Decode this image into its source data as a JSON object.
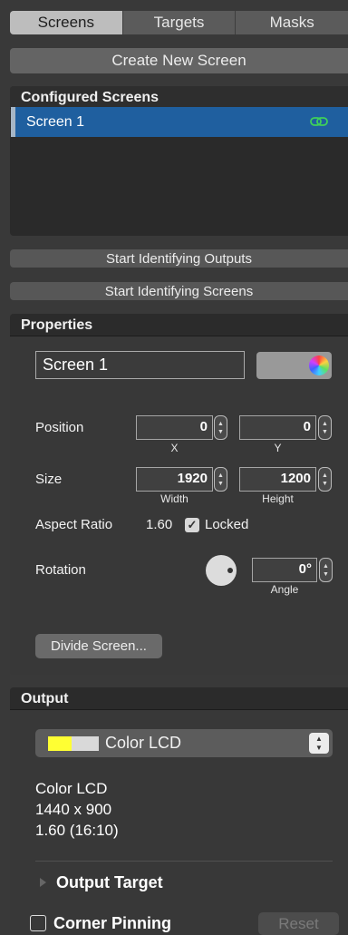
{
  "tabs": [
    {
      "label": "Screens",
      "active": true
    },
    {
      "label": "Targets",
      "active": false
    },
    {
      "label": "Masks",
      "active": false
    }
  ],
  "create_button": "Create New Screen",
  "configured": {
    "title": "Configured Screens",
    "items": [
      {
        "label": "Screen 1",
        "selected": true,
        "icon": "link-icon"
      }
    ]
  },
  "identify_outputs": "Start Identifying Outputs",
  "identify_screens": "Start Identifying Screens",
  "properties": {
    "title": "Properties",
    "name": "Screen 1",
    "position_label": "Position",
    "x_value": "0",
    "x_label": "X",
    "y_value": "0",
    "y_label": "Y",
    "size_label": "Size",
    "width_value": "1920",
    "width_label": "Width",
    "height_value": "1200",
    "height_label": "Height",
    "aspect_label": "Aspect Ratio",
    "aspect_value": "1.60",
    "locked_label": "Locked",
    "locked": true,
    "rotation_label": "Rotation",
    "angle_value": "0°",
    "angle_label": "Angle",
    "divide_button": "Divide Screen..."
  },
  "output": {
    "title": "Output",
    "selected_display": "Color LCD",
    "info_name": "Color LCD",
    "info_resolution": "1440 x 900",
    "info_ratio": "1.60 (16:10)",
    "output_target_label": "Output Target",
    "corner_pinning_label": "Corner Pinning",
    "corner_pinning": false,
    "reset_button": "Reset"
  },
  "colors": {
    "selection": "#1f5f9f",
    "link_icon": "#3fd05a",
    "swatch_yellow": "#ffff33"
  }
}
